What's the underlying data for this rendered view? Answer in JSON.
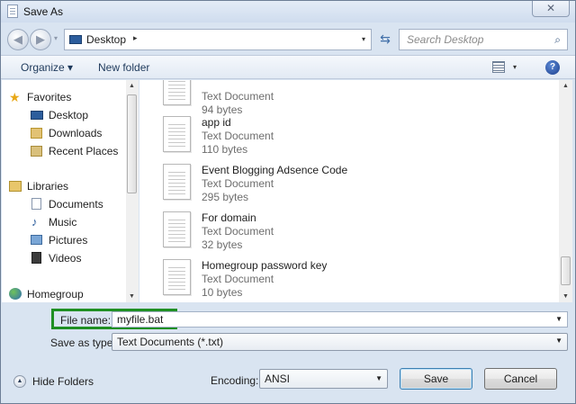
{
  "window": {
    "title": "Save As",
    "close_glyph": "✕"
  },
  "address_bar": {
    "location": "Desktop",
    "separator": "▸",
    "dropdown": "▾",
    "refresh": "⇆"
  },
  "search": {
    "placeholder": "Search Desktop",
    "icon": "⌕"
  },
  "toolbar": {
    "organize": "Organize ▾",
    "new_folder": "New folder",
    "help": "?",
    "view_drop": "▾"
  },
  "nav_pane": {
    "items": [
      {
        "label": "Favorites",
        "icon": "star-icon"
      },
      {
        "label": "Desktop",
        "icon": "desktop-icon"
      },
      {
        "label": "Downloads",
        "icon": "downloads-icon"
      },
      {
        "label": "Recent Places",
        "icon": "recent-places-icon"
      },
      {
        "label": "Libraries",
        "icon": "library-icon"
      },
      {
        "label": "Documents",
        "icon": "documents-icon"
      },
      {
        "label": "Music",
        "icon": "music-icon"
      },
      {
        "label": "Pictures",
        "icon": "pictures-icon"
      },
      {
        "label": "Videos",
        "icon": "videos-icon"
      },
      {
        "label": "Homegroup",
        "icon": "homegroup-icon"
      }
    ]
  },
  "files": [
    {
      "name": "",
      "type": "Text Document",
      "size": "94 bytes"
    },
    {
      "name": "app id",
      "type": "Text Document",
      "size": "110 bytes"
    },
    {
      "name": "Event Blogging Adsence Code",
      "type": "Text Document",
      "size": "295 bytes"
    },
    {
      "name": "For domain",
      "type": "Text Document",
      "size": "32 bytes"
    },
    {
      "name": "Homegroup password key",
      "type": "Text Document",
      "size": "10 bytes"
    }
  ],
  "form": {
    "file_name_label": "File name:",
    "file_name_value": "myfile.bat",
    "save_as_type_label": "Save as type:",
    "save_as_type_value": "Text Documents (*.txt)",
    "encoding_label": "Encoding:",
    "encoding_value": "ANSI"
  },
  "buttons": {
    "hide_folders": "Hide Folders",
    "save": "Save",
    "cancel": "Cancel"
  },
  "colors": {
    "highlight_box": "#1f8f23",
    "window_bg": "#d9e4f1"
  }
}
